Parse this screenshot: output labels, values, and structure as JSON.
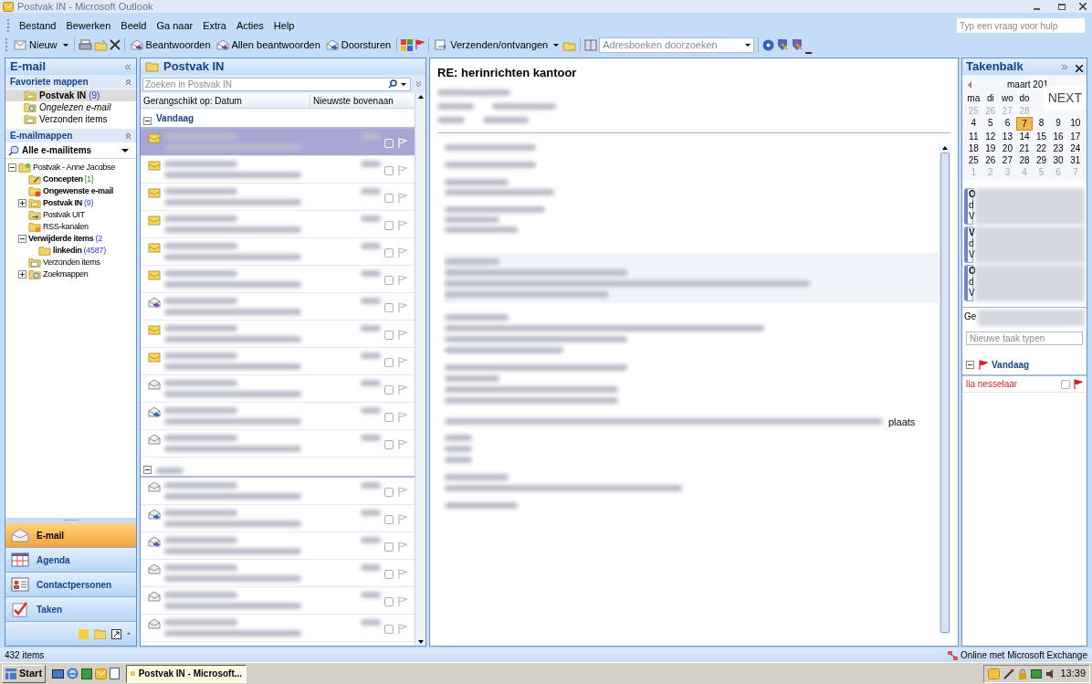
{
  "window": {
    "title": "Postvak IN - Microsoft Outlook"
  },
  "menu": [
    "Bestand",
    "Bewerken",
    "Beeld",
    "Ga naar",
    "Extra",
    "Acties",
    "Help"
  ],
  "help_search": {
    "placeholder": "Typ een vraag voor hulp"
  },
  "toolbar": {
    "new": "Nieuw",
    "reply": "Beantwoorden",
    "reply_all": "Allen beantwoorden",
    "forward": "Doorsturen",
    "send_receive": "Verzenden/ontvangen",
    "address_search": {
      "placeholder": "Adresboeken doorzoeken"
    }
  },
  "nav": {
    "title": "E-mail",
    "favorites_header": "Favoriete mappen",
    "favorites": [
      {
        "kind": "inbox",
        "label": "Postvak IN",
        "count": "(9)",
        "bold": true,
        "italic": false,
        "selected": true
      },
      {
        "kind": "search",
        "label": "Ongelezen e-mail",
        "bold": false,
        "italic": true,
        "selected": false
      },
      {
        "kind": "sent",
        "label": "Verzonden items",
        "bold": false,
        "italic": false,
        "selected": false
      }
    ],
    "folders_header": "E-mailmappen",
    "view": "Alle e-mailitems",
    "tree": [
      {
        "kind": "mailbox",
        "label": "Postvak - Anne Jacobse",
        "bold": false,
        "expanded": true,
        "children": [
          {
            "kind": "drafts",
            "label": "Concepten",
            "count": "[1]",
            "bold": true
          },
          {
            "kind": "junk",
            "label": "Ongewenste e-mail",
            "bold": true
          },
          {
            "kind": "inbox",
            "label": "Postvak IN",
            "count": "(9)",
            "bold": true,
            "expanded": false
          },
          {
            "kind": "outbox",
            "label": "Postvak UIT",
            "bold": false
          },
          {
            "kind": "rss",
            "label": "RSS-kanalen",
            "bold": false
          },
          {
            "kind": "trash",
            "label": "Verwijderde items",
            "count": "(2",
            "bold": true,
            "expanded": true,
            "children": [
              {
                "kind": "folder",
                "label": "linkedin",
                "count": "(4587)",
                "bold": true
              }
            ]
          },
          {
            "kind": "sent",
            "label": "Verzonden items",
            "bold": false
          },
          {
            "kind": "search",
            "label": "Zoekmappen",
            "bold": false,
            "expanded": false
          }
        ]
      }
    ],
    "buttons": [
      {
        "kind": "mail",
        "label": "E-mail",
        "selected": true
      },
      {
        "kind": "calendar",
        "label": "Agenda",
        "selected": false
      },
      {
        "kind": "contacts",
        "label": "Contactpersonen",
        "selected": false
      },
      {
        "kind": "tasks",
        "label": "Taken",
        "selected": false
      }
    ]
  },
  "list": {
    "title": "Postvak IN",
    "search": {
      "placeholder": "Zoeken in Postvak IN"
    },
    "arranged_by": "Gerangschikt op: Datum",
    "order": "Nieuwste bovenaan",
    "groups": [
      {
        "label": "Vandaag",
        "messages": [
          {
            "kind": "unread",
            "selected": true
          },
          {
            "kind": "unread",
            "selected": false
          },
          {
            "kind": "unread",
            "selected": false
          },
          {
            "kind": "unread",
            "selected": false
          },
          {
            "kind": "unread",
            "selected": false
          },
          {
            "kind": "unread",
            "selected": false
          },
          {
            "kind": "replied",
            "selected": false
          },
          {
            "kind": "unread",
            "selected": false
          },
          {
            "kind": "unread",
            "selected": false
          },
          {
            "kind": "read",
            "selected": false
          },
          {
            "kind": "forwarded",
            "selected": false
          },
          {
            "kind": "read",
            "selected": false
          }
        ]
      },
      {
        "messages": [
          {
            "kind": "read",
            "selected": false
          },
          {
            "kind": "forwarded",
            "selected": false
          },
          {
            "kind": "replied",
            "selected": false
          },
          {
            "kind": "read",
            "selected": false
          },
          {
            "kind": "read",
            "selected": false
          },
          {
            "kind": "read",
            "selected": false
          }
        ]
      }
    ]
  },
  "reading": {
    "subject": "RE: herinrichten kantoor",
    "fragment": "plaats"
  },
  "todo": {
    "title": "Takenbalk",
    "month": "maart 201",
    "weekdays": [
      "ma",
      "di",
      "wo",
      "do"
    ],
    "overlay": "NEXT",
    "weeks": [
      {
        "muted": true,
        "days": [
          {
            "day": "25",
            "today": false
          },
          {
            "day": "26",
            "today": false
          },
          {
            "day": "27",
            "today": false
          },
          {
            "day": "28",
            "today": false
          }
        ]
      },
      {
        "muted": false,
        "days": [
          {
            "day": "4",
            "today": false
          },
          {
            "day": "5",
            "today": false
          },
          {
            "day": "6",
            "today": false
          },
          {
            "day": "7",
            "today": true
          },
          {
            "day": "8",
            "today": false
          },
          {
            "day": "9",
            "today": false
          },
          {
            "day": "10",
            "today": false
          }
        ]
      },
      {
        "muted": false,
        "days": [
          {
            "day": "11",
            "today": false
          },
          {
            "day": "12",
            "today": false
          },
          {
            "day": "13",
            "today": false
          },
          {
            "day": "14",
            "today": false
          },
          {
            "day": "15",
            "today": false
          },
          {
            "day": "16",
            "today": false
          },
          {
            "day": "17",
            "today": false
          }
        ]
      },
      {
        "muted": false,
        "days": [
          {
            "day": "18",
            "today": false
          },
          {
            "day": "19",
            "today": false
          },
          {
            "day": "20",
            "today": false
          },
          {
            "day": "21",
            "today": false
          },
          {
            "day": "22",
            "today": false
          },
          {
            "day": "23",
            "today": false
          },
          {
            "day": "24",
            "today": false
          }
        ]
      },
      {
        "muted": false,
        "days": [
          {
            "day": "25",
            "today": false
          },
          {
            "day": "26",
            "today": false
          },
          {
            "day": "27",
            "today": false
          },
          {
            "day": "28",
            "today": false
          },
          {
            "day": "29",
            "today": false
          },
          {
            "day": "30",
            "today": false
          },
          {
            "day": "31",
            "today": false
          }
        ]
      },
      {
        "muted": true,
        "days": [
          {
            "day": "1",
            "today": false
          },
          {
            "day": "2",
            "today": false
          },
          {
            "day": "3",
            "today": false
          },
          {
            "day": "4",
            "today": false
          },
          {
            "day": "5",
            "today": false
          },
          {
            "day": "6",
            "today": false
          },
          {
            "day": "7",
            "today": false
          }
        ]
      }
    ],
    "appointments": [
      {
        "lines": [
          "O",
          "d",
          "V"
        ]
      },
      {
        "lines": [
          "V",
          "d",
          "V"
        ]
      },
      {
        "lines": [
          "O",
          "d",
          "V"
        ]
      }
    ],
    "tasks_header": "Ge",
    "new_task": {
      "placeholder": "Nieuwe taak typen"
    },
    "task_group": "Vandaag",
    "tasks": [
      {
        "label": "lia nesselaar",
        "checked": false
      }
    ]
  },
  "status_bar": {
    "items": "432 items",
    "connection": "Online met Microsoft Exchange"
  },
  "taskbar": {
    "start": "Start",
    "window": "Postvak IN - Microsoft...",
    "clock": "13:39"
  }
}
